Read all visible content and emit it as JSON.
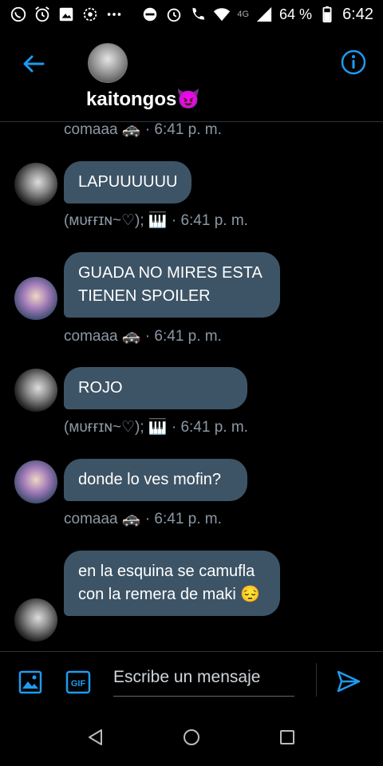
{
  "status_bar": {
    "left_icons": [
      "whatsapp-icon",
      "alarm-icon",
      "gallery-icon",
      "settings-icon",
      "more-icon"
    ],
    "right_icons": [
      "dnd-icon",
      "alarm-icon",
      "call-4g-icon",
      "wifi-icon",
      "signal-4g-icon",
      "battery-icon"
    ],
    "network_label": "4G",
    "battery": "64 %",
    "time": "6:42"
  },
  "header": {
    "title": "kaitongos😈",
    "back_icon": "arrow-left-icon",
    "info_icon": "info-icon"
  },
  "messages": {
    "top_meta": "comaaa 🚓 · 6:41 p. m.",
    "items": [
      {
        "text": "LAPUUUUUU",
        "meta": "(ᴍᴜғғɪɴ~♡); 🎹 · 6:41 p. m."
      },
      {
        "text": "GUADA NO MIRES ESTA TIENEN SPOILER",
        "meta": "comaaa 🚓 · 6:41 p. m."
      },
      {
        "text": "ROJO",
        "meta": "(ᴍᴜғғɪɴ~♡); 🎹 · 6:41 p. m."
      },
      {
        "text": "donde lo ves mofin?",
        "meta": "comaaa 🚓 · 6:41 p. m."
      },
      {
        "text": "en la esquina se camufla con la remera de maki 😔",
        "meta": ""
      }
    ]
  },
  "composer": {
    "placeholder": "Escribe un mensaje",
    "gif_label": "GIF",
    "image_icon": "image-icon",
    "send_icon": "send-icon"
  },
  "navbar": {
    "icons": [
      "nav-back-icon",
      "nav-home-icon",
      "nav-recent-icon"
    ]
  },
  "colors": {
    "accent": "#1d9bf0",
    "bubble": "#3d5466",
    "meta": "#8b98a5",
    "background": "#000000"
  }
}
